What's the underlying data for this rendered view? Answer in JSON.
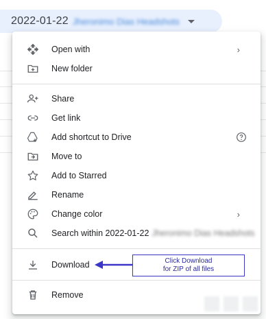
{
  "folder_chip": {
    "date": "2022-01-22",
    "name": "Jheronimo Dias Headshots"
  },
  "menu": {
    "items": [
      {
        "label": "Open with",
        "icon": "open-with-icon",
        "has_submenu": true
      },
      {
        "label": "New folder",
        "icon": "new-folder-icon"
      },
      {
        "label": "Share",
        "icon": "share-person-icon"
      },
      {
        "label": "Get link",
        "icon": "link-icon"
      },
      {
        "label": "Add shortcut to Drive",
        "icon": "add-shortcut-icon",
        "has_help": true
      },
      {
        "label": "Move to",
        "icon": "move-to-icon"
      },
      {
        "label": "Add to Starred",
        "icon": "star-icon"
      },
      {
        "label": "Rename",
        "icon": "rename-pencil-icon"
      },
      {
        "label": "Change color",
        "icon": "palette-icon",
        "has_submenu": true
      },
      {
        "label": "Search within 2022-01-22",
        "icon": "search-icon",
        "blurred_suffix": "Jheronimo Dias Headshots"
      },
      {
        "label": "Download",
        "icon": "download-icon"
      },
      {
        "label": "Remove",
        "icon": "trash-icon"
      }
    ],
    "submenu_glyph": "›"
  },
  "callout": {
    "line1": "Click Download",
    "line2": "for ZIP of all files",
    "color": "#3b35c8"
  }
}
